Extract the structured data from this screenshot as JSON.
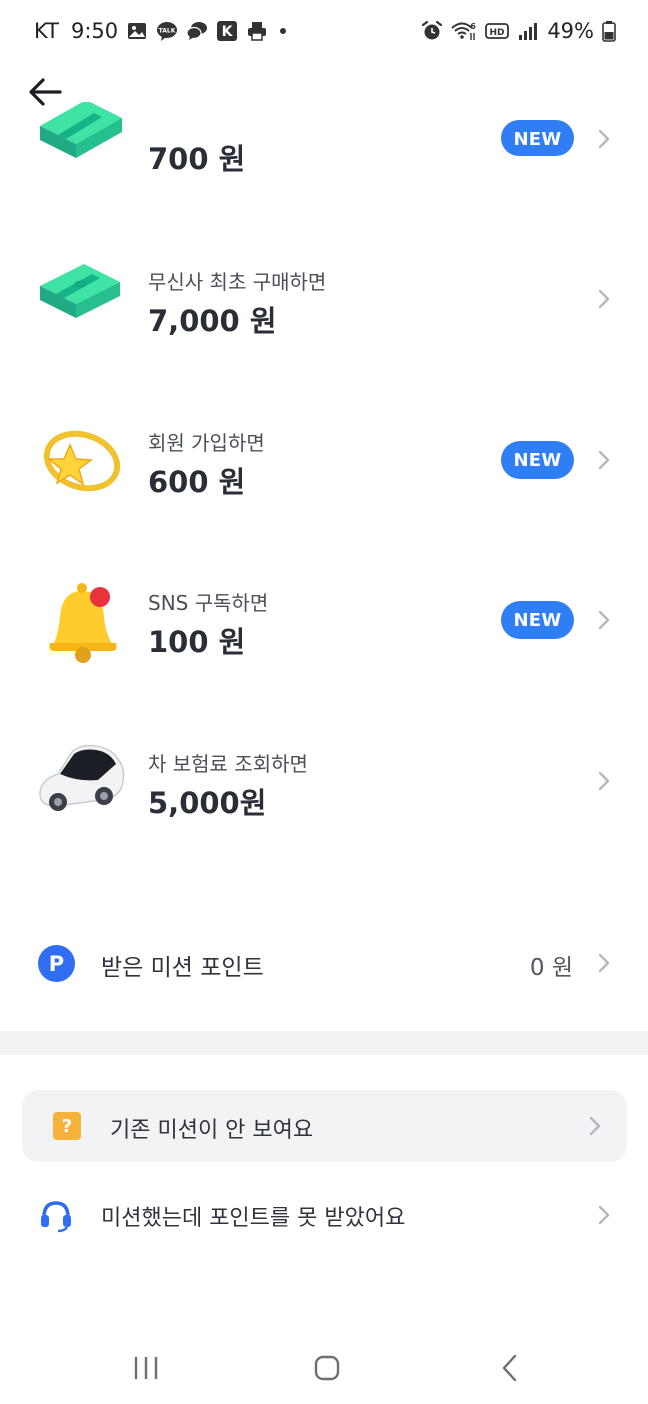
{
  "status_bar": {
    "carrier": "KT",
    "time": "9:50",
    "talk_label": "TALK",
    "k_label": "K",
    "hd_label": "HD",
    "wifi_label": "6",
    "battery": "49%"
  },
  "missions": [
    {
      "title": "",
      "amount": "700 원",
      "badge": "NEW",
      "icon": "money-stack-icon"
    },
    {
      "title": "무신사 최초 구매하면",
      "amount": "7,000 원",
      "badge": "",
      "icon": "money-stack-icon"
    },
    {
      "title": "회원 가입하면",
      "amount": "600 원",
      "badge": "NEW",
      "icon": "star-ring-icon"
    },
    {
      "title": "SNS 구독하면",
      "amount": "100 원",
      "badge": "NEW",
      "icon": "bell-icon"
    },
    {
      "title": "차 보험료 조회하면",
      "amount": "5,000원",
      "badge": "",
      "icon": "car-icon"
    }
  ],
  "points": {
    "icon_letter": "P",
    "label": "받은 미션 포인트",
    "value": "0 원"
  },
  "help": {
    "missing_mission": {
      "icon_glyph": "?",
      "label": "기존 미션이 안 보여요"
    },
    "no_points": {
      "label": "미션했는데 포인트를 못 받았어요"
    }
  },
  "colors": {
    "accent_blue": "#2f7ef6",
    "points_blue": "#2f6ef0",
    "help_orange": "#f7b23b",
    "card_bg": "#f2f3f5"
  }
}
